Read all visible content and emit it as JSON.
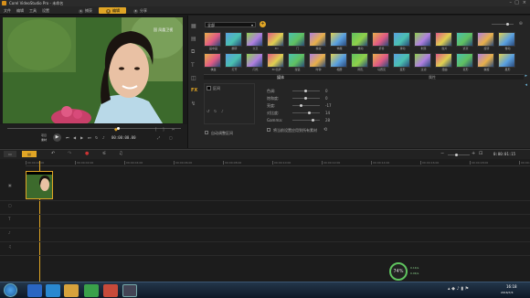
{
  "window": {
    "title": "Corel VideoStudio Pro - 未命名"
  },
  "menu": [
    "文件",
    "编辑",
    "工具",
    "设置"
  ],
  "steps": [
    {
      "num": "1",
      "label": "捕获"
    },
    {
      "num": "2",
      "label": "编辑"
    },
    {
      "num": "3",
      "label": "分享"
    }
  ],
  "preview": {
    "watermark": "国 凤凰卫视"
  },
  "player": {
    "mode_project": "项目",
    "mode_clip": "素材",
    "timecode": "00:00:00.00"
  },
  "library": {
    "category": "全部",
    "tabs": [
      "媒体",
      "属性"
    ],
    "row1": [
      "画中画",
      "翻转",
      "交叉",
      "3D",
      "门",
      "擦拭",
      "伸展",
      "推动",
      "折叠",
      "滑动",
      "剥落",
      "胶片",
      "遮罩",
      "旋转",
      "卷动"
    ],
    "row2": [
      "棋盘",
      "打开",
      "闪光",
      "3D比萨",
      "拉链",
      "时钟",
      "相册",
      "网孔",
      "马赛克",
      "变形",
      "过滤",
      "扭曲",
      "菱形",
      "螺旋",
      "星形"
    ]
  },
  "options": {
    "duration_label": "区间",
    "checkbox_label": "自动调整区间",
    "props": [
      {
        "label": "色调:",
        "value": "0"
      },
      {
        "label": "饱和度:",
        "value": "0"
      },
      {
        "label": "亮度:",
        "value": "-17"
      },
      {
        "label": "对比度:",
        "value": "14"
      },
      {
        "label": "Gamma:",
        "value": "28"
      }
    ],
    "apply_label": "将当前设置应用到所有素材",
    "reset_label": "重置"
  },
  "timeline": {
    "timecode": "0:00:01:15",
    "ruler": [
      "00:00:00:00",
      "00:00:02:00",
      "00:00:04:00",
      "00:00:06:00",
      "00:00:08:00",
      "00:00:10:00",
      "00:00:12:00",
      "00:00:14:00",
      "00:00:16:00",
      "00:00:18:00",
      "00:00:20:00"
    ]
  },
  "tray": {
    "clock_time": "16:18",
    "clock_date": "2016/7/4",
    "net_percent": "74%",
    "speed_up": "0.1K/s",
    "speed_down": "0.0K/s"
  },
  "colors": {
    "accent": "#e0a525",
    "bg": "#1a1a1a",
    "panel": "#252525"
  }
}
